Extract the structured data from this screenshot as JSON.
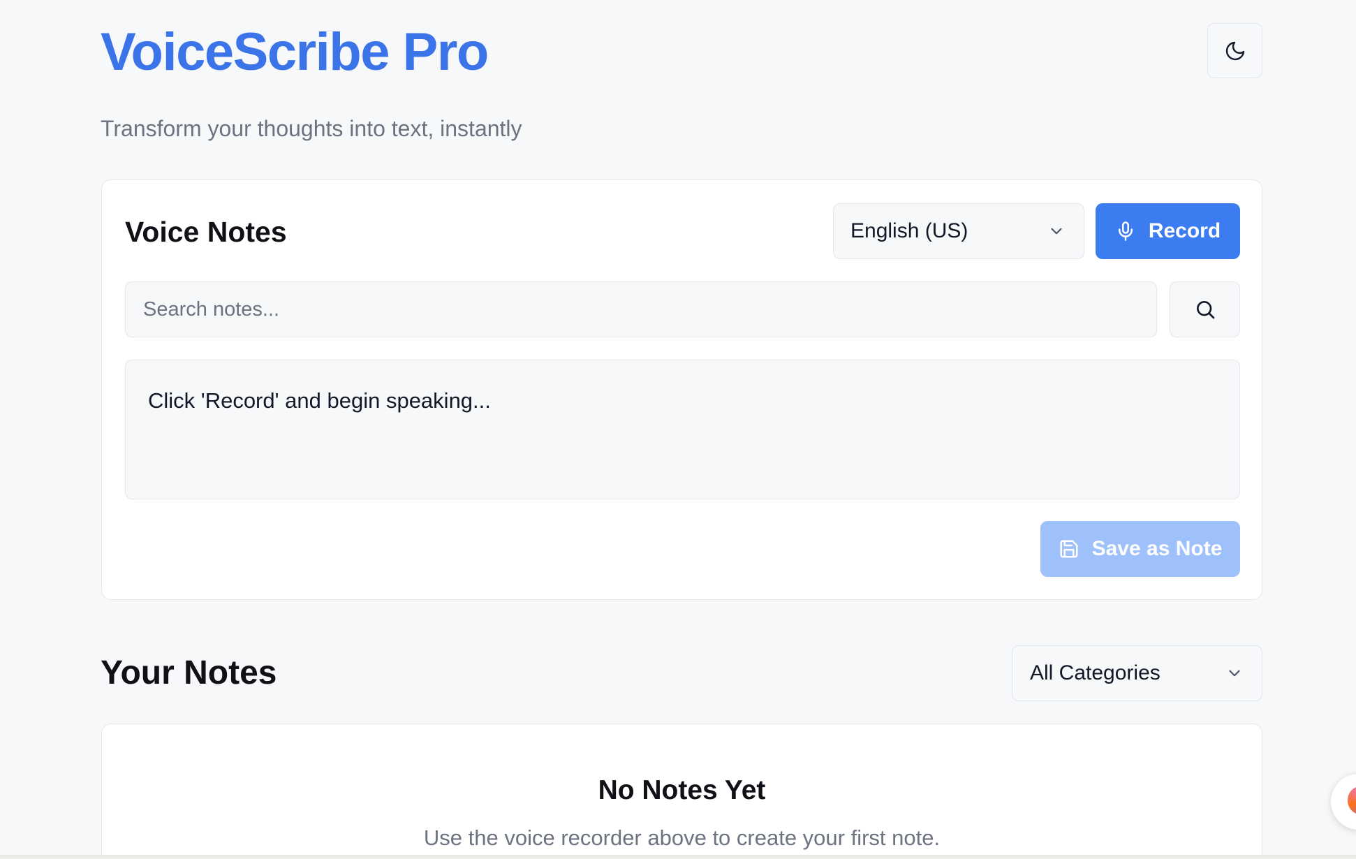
{
  "header": {
    "title": "VoiceScribe Pro",
    "subtitle": "Transform your thoughts into text, instantly",
    "theme_toggle_icon": "moon-icon"
  },
  "recorder": {
    "title": "Voice Notes",
    "language": {
      "selected": "English (US)"
    },
    "record_label": "Record",
    "search": {
      "placeholder": "Search notes...",
      "value": ""
    },
    "transcript_text": "Click 'Record' and begin speaking...",
    "save_label": "Save as Note",
    "save_disabled": true
  },
  "notes": {
    "heading": "Your Notes",
    "category_filter": {
      "selected": "All Categories"
    },
    "empty_title": "No Notes Yet",
    "empty_description": "Use the voice recorder above to create your first note."
  },
  "colors": {
    "accent": "#3b7cf0",
    "title_blue": "#3b74e8",
    "disabled_button": "#9ec0fb",
    "background": "#f7f8fa",
    "muted_text": "#6b7280"
  }
}
